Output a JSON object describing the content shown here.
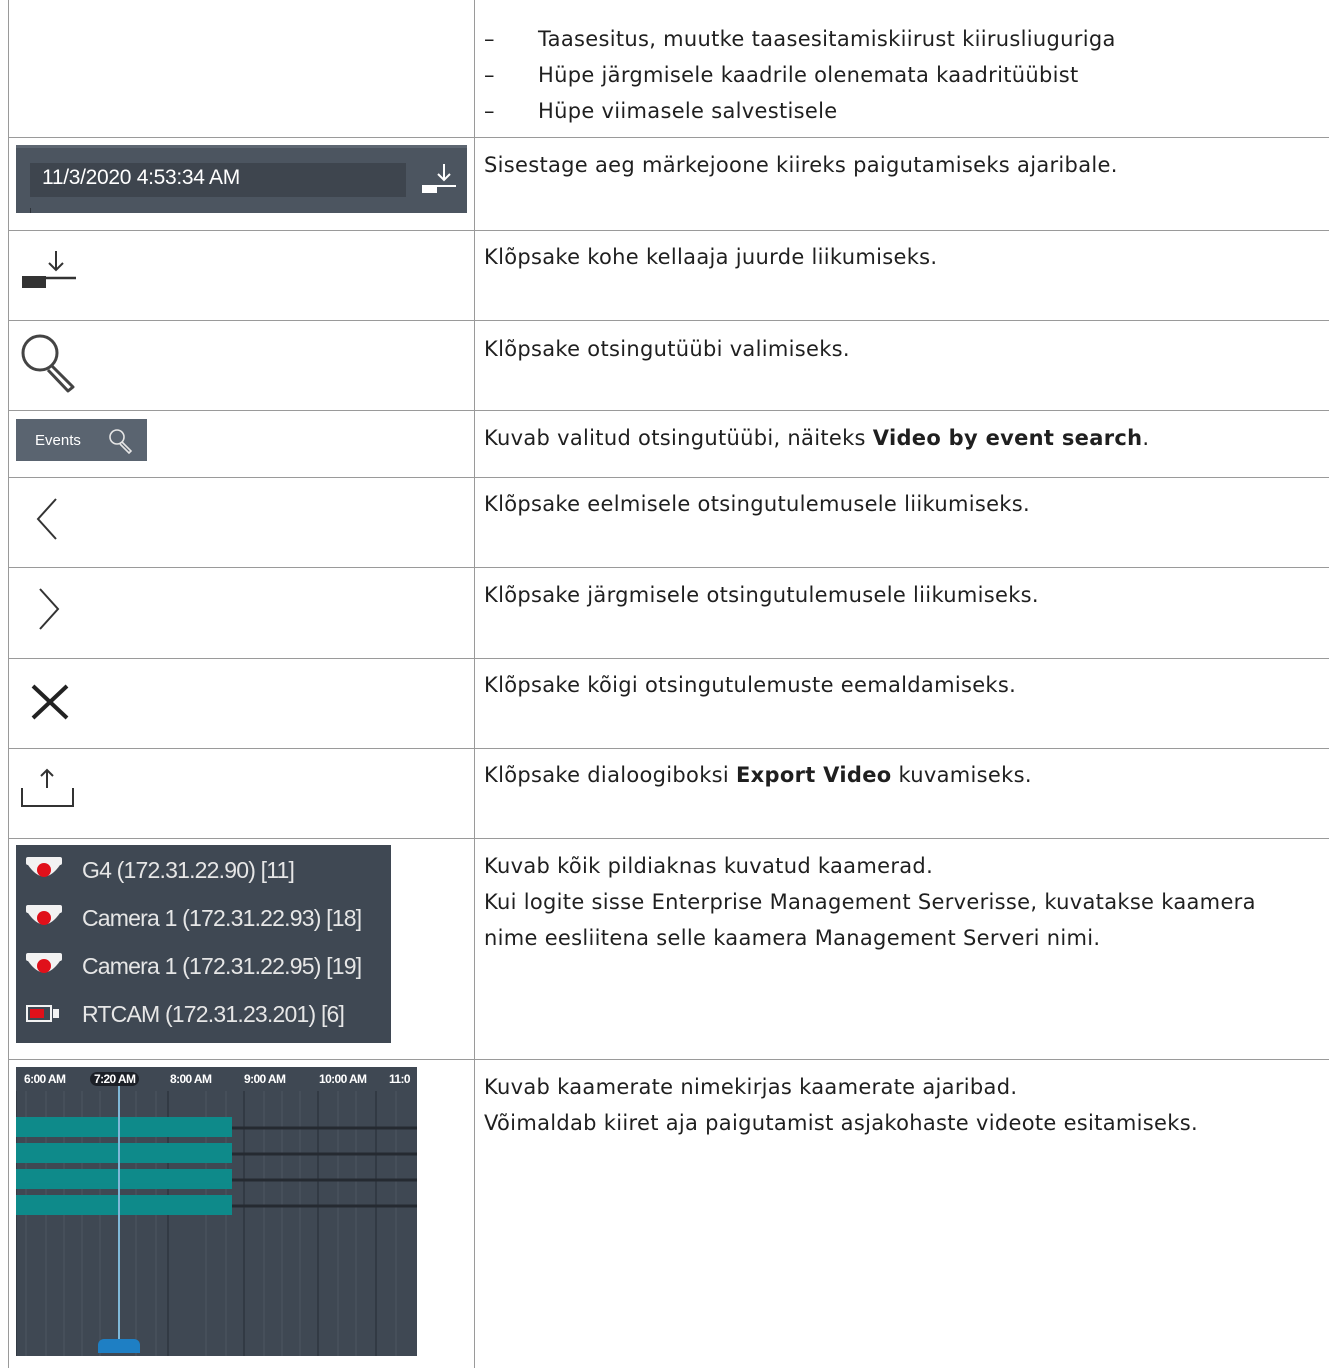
{
  "rows": {
    "playback_bullets": [
      "Taasesitus, muutke taasesitamiskiirust kiirusliuguriga",
      "Hüpe järgmisele kaadrile olenemata kaadritüübist",
      "Hüpe viimasele salvestisele"
    ],
    "bullet_dash": "–",
    "date_field": {
      "value": "11/3/2020 4:53:34 AM",
      "description": "Sisestage aeg märkejoone kiireks paigutamiseks ajaribale."
    },
    "jump_to_time": {
      "icon": "jump-to-time-icon",
      "description": "Klõpsake kohe kellaaja juurde liikumiseks."
    },
    "search_type": {
      "icon": "search-icon",
      "description": "Klõpsake otsingutüübi valimiseks."
    },
    "events_button": {
      "label": "Events",
      "description_before": "Kuvab valitud otsingutüübi, näiteks ",
      "description_bold": "Video by event search",
      "description_after": "."
    },
    "previous_result": {
      "icon": "chevron-left-icon",
      "description": "Klõpsake eelmisele otsingutulemusele liikumiseks."
    },
    "next_result": {
      "icon": "chevron-right-icon",
      "description": "Klõpsake järgmisele otsingutulemusele liikumiseks."
    },
    "clear_results": {
      "icon": "close-icon",
      "description": "Klõpsake kõigi otsingutulemuste eemaldamiseks."
    },
    "export_video": {
      "icon": "export-icon",
      "description_before": "Klõpsake dialoogiboksi ",
      "description_bold": "Export Video",
      "description_after": " kuvamiseks."
    },
    "camera_list": {
      "cameras": [
        {
          "name": "G4 (172.31.22.90) [11]",
          "icon": "dome-camera-icon"
        },
        {
          "name": "Camera 1 (172.31.22.93) [18]",
          "icon": "dome-camera-icon"
        },
        {
          "name": "Camera 1 (172.31.22.95) [19]",
          "icon": "dome-camera-icon"
        },
        {
          "name": "RTCAM (172.31.23.201) [6]",
          "icon": "box-camera-icon"
        }
      ],
      "description_lines": [
        "Kuvab kõik pildiaknas kuvatud kaamerad.",
        "Kui logite sisse Enterprise Management Serverisse, kuvatakse kaamera",
        "nime eesliitena selle kaamera Management Serveri nimi."
      ]
    },
    "timeline": {
      "labels": [
        "6:00 AM",
        "7:20 AM",
        "8:00 AM",
        "9:00 AM",
        "10:00 AM",
        "11:0"
      ],
      "active_label": "7:20 AM",
      "description_lines": [
        "Kuvab kaamerate nimekirjas kaamerate ajaribad.",
        "Võimaldab kiiret aja paigutamist asjakohaste videote esitamiseks."
      ]
    }
  },
  "colors": {
    "panel": "#3f4853",
    "recording_bar": "#0e8a8a",
    "camera_red": "#e0101a",
    "cursor_line": "#7fb8d8"
  }
}
